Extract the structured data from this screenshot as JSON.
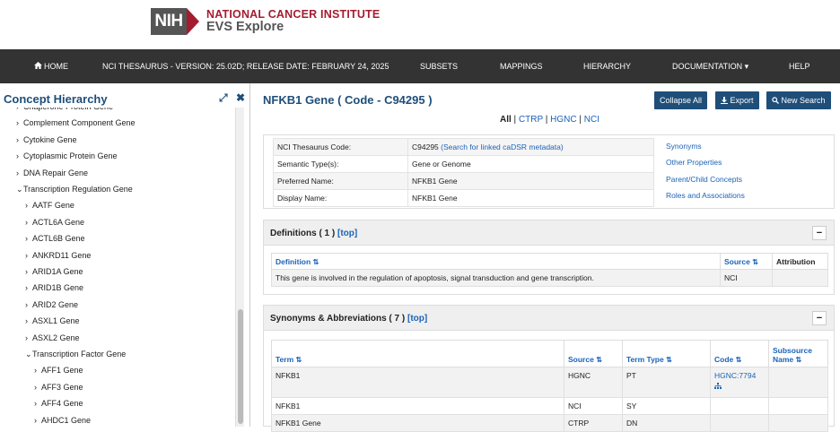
{
  "header": {
    "nih": "NIH",
    "line1": "NATIONAL CANCER INSTITUTE",
    "line2": "EVS Explore"
  },
  "nav": {
    "home": "HOME",
    "thesaurus": "NCI THESAURUS - VERSION: 25.02D; RELEASE DATE: FEBRUARY 24, 2025",
    "subsets": "SUBSETS",
    "mappings": "MAPPINGS",
    "hierarchy": "HIERARCHY",
    "documentation": "DOCUMENTATION ▾",
    "help": "HELP"
  },
  "sidebar": {
    "title": "Concept Hierarchy",
    "expand_icon": "⤢",
    "close_icon": "✖",
    "items": [
      {
        "label": "Chaperone Protein Gene",
        "chev": "›"
      },
      {
        "label": "Complement Component Gene",
        "chev": "›"
      },
      {
        "label": "Cytokine Gene",
        "chev": "›"
      },
      {
        "label": "Cytoplasmic Protein Gene",
        "chev": "›"
      },
      {
        "label": "DNA Repair Gene",
        "chev": "›"
      },
      {
        "label": "Transcription Regulation Gene",
        "chev": "⌄"
      },
      {
        "label": "AATF Gene",
        "chev": "›"
      },
      {
        "label": "ACTL6A Gene",
        "chev": "›"
      },
      {
        "label": "ACTL6B Gene",
        "chev": "›"
      },
      {
        "label": "ANKRD11 Gene",
        "chev": "›"
      },
      {
        "label": "ARID1A Gene",
        "chev": "›"
      },
      {
        "label": "ARID1B Gene",
        "chev": "›"
      },
      {
        "label": "ARID2 Gene",
        "chev": "›"
      },
      {
        "label": "ASXL1 Gene",
        "chev": "›"
      },
      {
        "label": "ASXL2 Gene",
        "chev": "›"
      },
      {
        "label": "Transcription Factor Gene",
        "chev": "⌄"
      },
      {
        "label": "AFF1 Gene",
        "chev": "›"
      },
      {
        "label": "AFF3 Gene",
        "chev": "›"
      },
      {
        "label": "AFF4 Gene",
        "chev": "›"
      },
      {
        "label": "AHDC1 Gene",
        "chev": "›"
      }
    ]
  },
  "main": {
    "title": "NFKB1 Gene ( Code - C94295 )",
    "collapse_all": "Collapse All",
    "export": "Export",
    "new_search": "New Search",
    "filter": {
      "all": "All",
      "sep": " | ",
      "ctrp": "CTRP",
      "hgnc": "HGNC",
      "nci": "NCI"
    },
    "info": {
      "rows": [
        {
          "label": "NCI Thesaurus Code:",
          "value": "C94295",
          "link": "(Search for linked caDSR metadata)"
        },
        {
          "label": "Semantic Type(s):",
          "value": "Gene or Genome",
          "link": ""
        },
        {
          "label": "Preferred Name:",
          "value": "NFKB1 Gene",
          "link": ""
        },
        {
          "label": "Display Name:",
          "value": "NFKB1 Gene",
          "link": ""
        }
      ],
      "links": [
        "Synonyms",
        "Other Properties",
        "Parent/Child Concepts",
        "Roles and Associations"
      ]
    },
    "definitions": {
      "title": "Definitions ( 1 )",
      "top": "[top]",
      "col_def": "Definition",
      "col_source": "Source",
      "col_attr": "Attribution",
      "rows": [
        {
          "definition": "This gene is involved in the regulation of apoptosis, signal transduction and gene transcription.",
          "source": "NCI",
          "attribution": ""
        }
      ]
    },
    "synonyms": {
      "title": "Synonyms & Abbreviations ( 7 )",
      "top": "[top]",
      "col_term": "Term",
      "col_source": "Source",
      "col_type": "Term Type",
      "col_code": "Code",
      "col_subsource": "Subsource Name",
      "sort": "⇅",
      "rows": [
        {
          "term": "NFKB1",
          "source": "HGNC",
          "type": "PT",
          "code": "HGNC:7794",
          "subsource": ""
        },
        {
          "term": "NFKB1",
          "source": "NCI",
          "type": "SY",
          "code": "",
          "subsource": ""
        },
        {
          "term": "NFKB1 Gene",
          "source": "CTRP",
          "type": "DN",
          "code": "",
          "subsource": ""
        }
      ]
    }
  },
  "colors": {
    "navbar": "#333333",
    "primary": "#1f4e79",
    "link": "#1a63b8",
    "nih_red": "#a51c30"
  }
}
